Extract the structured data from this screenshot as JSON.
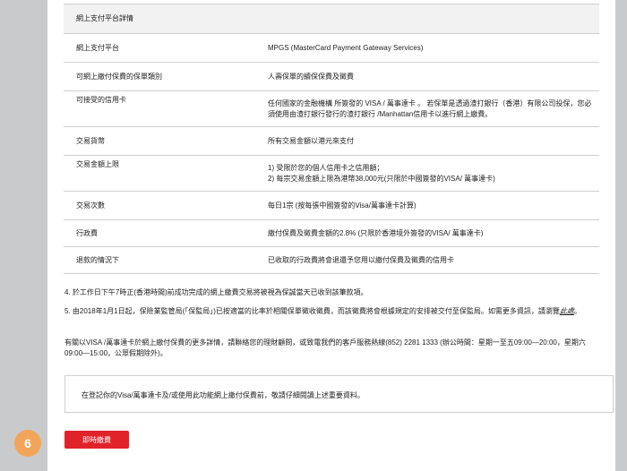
{
  "table": {
    "header": "網上支付平台詳情",
    "rows": [
      {
        "label": "網上支付平台",
        "value": "MPGS (MasterCard Payment Gateway Services)"
      },
      {
        "label": "可網上繳付保費的保單類別",
        "value": "人壽保單的續保保費及徵費"
      },
      {
        "label": "可接受的信用卡",
        "value": "任何國家的金融機構 所簽發的 VISA / 萬事達卡 。 若保單是透過渣打銀行（香港）有限公司投保，您必須使用由渣打銀行發行的渣打銀行 /Manhattan信用卡以進行網上繳費。"
      },
      {
        "label": "交易貨幣",
        "value": "所有交易金額以港元來支付"
      },
      {
        "label": "交易金額上限",
        "value_lines": [
          "1) 受限於您的個人信用卡之信用額；",
          "2) 每宗交易金額上限為港幣38,000元(只限於中國簽發的VISA/ 萬事達卡)"
        ]
      },
      {
        "label": "交易次數",
        "value": "每日1宗 (按每張中國簽發的Visa/萬事達卡計算)"
      },
      {
        "label": "行政費",
        "value": "繳付保費及徵費金額的2.8% (只限於香港境外簽發的VISA/ 萬事達卡)"
      },
      {
        "label": "退款的情況下",
        "value": "已收取的行政費將會退還予您用以繳付保費及徵費的信用卡"
      }
    ]
  },
  "notes": {
    "note4": "4. 於工作日下午7時正(香港時間)前成功完成的網上繳費交易將被視為保誠當天已收到該筆款項。",
    "note5_text": "5. 由2018年1月1日起，保險業監管局(「保監局」)已按適當的比率於相關保單徵收徵費，而該徵費將會根據規定的安排被交付至保監局。如需更多資訊，請瀏覽",
    "note5_link": "此處",
    "note5_end": "。"
  },
  "enquiry": "有關以VISA /萬事達卡於網上繳付保費的更多詳情，請聯絡您的理財顧問，或致電我們的客戶服務熱線(852) 2281 1333 (辦公時間：星期一至五09:00—20:00，星期六09:00—15:00，公眾假期除外)。",
  "notice": "在登記你的Visa/萬事達卡及/或使用此功能網上繳付保費前，敬請仔細閱讀上述重要資料。",
  "pay_button": "即時繳費",
  "step_badge": "6"
}
